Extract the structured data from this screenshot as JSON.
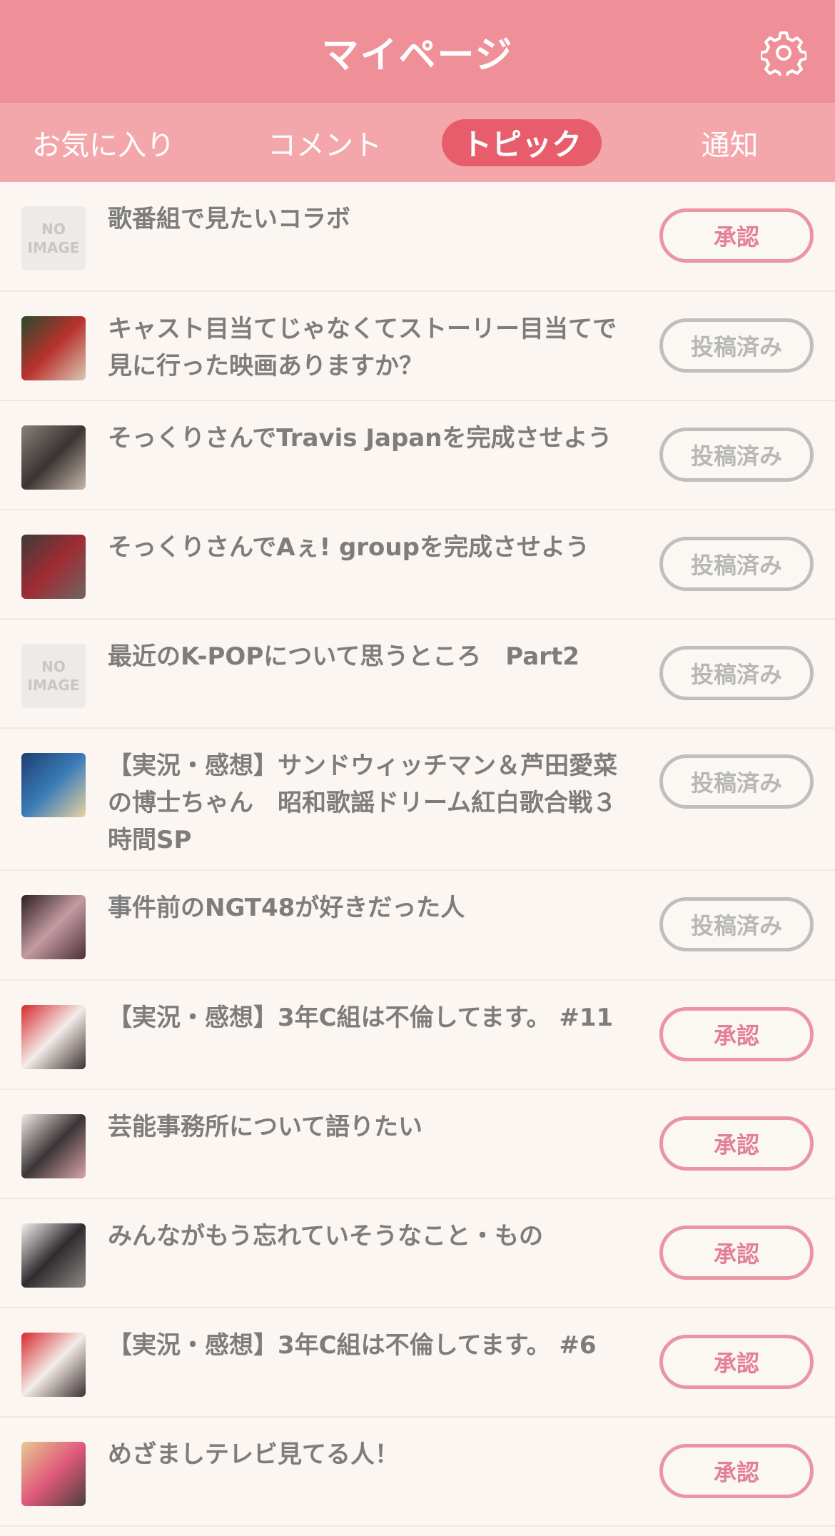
{
  "header": {
    "title": "マイページ",
    "settings_icon": "gear-icon"
  },
  "tabs": [
    {
      "label": "お気に入り",
      "active": false
    },
    {
      "label": "コメント",
      "active": false
    },
    {
      "label": "トピック",
      "active": true
    },
    {
      "label": "通知",
      "active": false
    }
  ],
  "topics": [
    {
      "title": "歌番組で見たいコラボ",
      "status": "承認",
      "thumb": "no-image",
      "noimage_label": [
        "NO",
        "IMAGE"
      ]
    },
    {
      "title": "キャスト目当てじゃなくてストーリー目当てで見に行った映画ありますか？",
      "status": "投稿済み",
      "thumb": "photo",
      "colors": [
        "#2a4a2c",
        "#b8322d",
        "#d8c9b5"
      ]
    },
    {
      "title": "そっくりさんでTravis Japanを完成させよう",
      "status": "投稿済み",
      "thumb": "photo",
      "colors": [
        "#8a7f7a",
        "#3a3433",
        "#c7b7a8"
      ]
    },
    {
      "title": "そっくりさんでAぇ! groupを完成させよう",
      "status": "投稿済み",
      "thumb": "photo",
      "colors": [
        "#3e3a3b",
        "#9e2c33",
        "#6e6663"
      ]
    },
    {
      "title": "最近のK-POPについて思うところ　Part2",
      "status": "投稿済み",
      "thumb": "no-image",
      "noimage_label": [
        "NO",
        "IMAGE"
      ]
    },
    {
      "title": "【実況・感想】サンドウィッチマン＆芦田愛菜の博士ちゃん　昭和歌謡ドリーム紅白歌合戦３時間SP",
      "status": "投稿済み",
      "thumb": "photo",
      "colors": [
        "#1d3f6e",
        "#3b7bb8",
        "#e8d4a0"
      ]
    },
    {
      "title": "事件前のNGT48が好きだった人",
      "status": "投稿済み",
      "thumb": "photo",
      "colors": [
        "#2b1f24",
        "#c59aa2",
        "#4a2f38"
      ]
    },
    {
      "title": "【実況・感想】3年C組は不倫してます。 #11",
      "status": "承認",
      "thumb": "photo",
      "colors": [
        "#d8282e",
        "#f3ece8",
        "#3b3030"
      ]
    },
    {
      "title": "芸能事務所について語りたい",
      "status": "承認",
      "thumb": "photo",
      "colors": [
        "#f2e9e6",
        "#3a3536",
        "#d9a3a7"
      ]
    },
    {
      "title": "みんながもう忘れていそうなこと・もの",
      "status": "承認",
      "thumb": "photo",
      "colors": [
        "#f4f2ef",
        "#2e2c2f",
        "#8f8a86"
      ]
    },
    {
      "title": "【実況・感想】3年C組は不倫してます。 #6",
      "status": "承認",
      "thumb": "photo",
      "colors": [
        "#d8282e",
        "#f3ece8",
        "#3b3030"
      ]
    },
    {
      "title": "めざましテレビ見てる人！",
      "status": "承認",
      "thumb": "photo",
      "colors": [
        "#e7c98e",
        "#e05a7c",
        "#4b3f3c"
      ]
    }
  ],
  "colors": {
    "header": "#ef8f98",
    "tab_bar": "#f4a7ab",
    "active_tab": "#e85d6c",
    "approve": "#e48096",
    "posted": "#b7b8b6",
    "background": "#fbf6f1"
  }
}
